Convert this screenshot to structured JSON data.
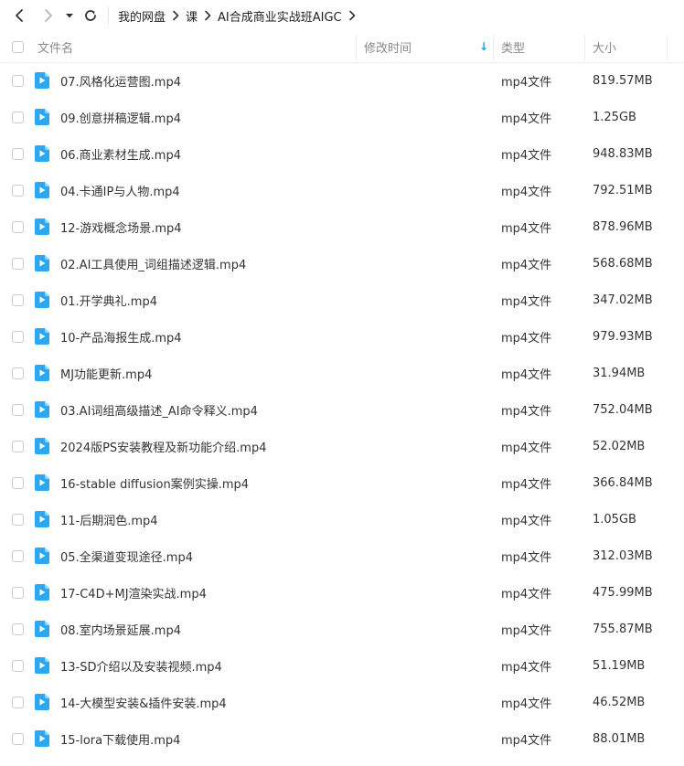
{
  "breadcrumb": [
    "我的网盘",
    "课",
    "AI合成商业实战班AIGC"
  ],
  "columns": {
    "name": "文件名",
    "modified": "修改时间",
    "type": "类型",
    "size": "大小"
  },
  "sort": {
    "column": "modified",
    "indicator": "↓"
  },
  "colors": {
    "accent": "#06a7ff",
    "icon_blue": "#2aa8f2"
  },
  "files": [
    {
      "name": "07.风格化运营图.mp4",
      "type": "mp4文件",
      "size": "819.57MB"
    },
    {
      "name": "09.创意拼稿逻辑.mp4",
      "type": "mp4文件",
      "size": "1.25GB"
    },
    {
      "name": "06.商业素材生成.mp4",
      "type": "mp4文件",
      "size": "948.83MB"
    },
    {
      "name": "04.卡通IP与人物.mp4",
      "type": "mp4文件",
      "size": "792.51MB"
    },
    {
      "name": "12-游戏概念场景.mp4",
      "type": "mp4文件",
      "size": "878.96MB"
    },
    {
      "name": "02.AI工具使用_词组描述逻辑.mp4",
      "type": "mp4文件",
      "size": "568.68MB"
    },
    {
      "name": "01.开学典礼.mp4",
      "type": "mp4文件",
      "size": "347.02MB"
    },
    {
      "name": "10-产品海报生成.mp4",
      "type": "mp4文件",
      "size": "979.93MB"
    },
    {
      "name": "MJ功能更新.mp4",
      "type": "mp4文件",
      "size": "31.94MB"
    },
    {
      "name": "03.AI词组高级描述_AI命令释义.mp4",
      "type": "mp4文件",
      "size": "752.04MB"
    },
    {
      "name": "2024版PS安装教程及新功能介绍.mp4",
      "type": "mp4文件",
      "size": "52.02MB"
    },
    {
      "name": "16-stable diffusion案例实操.mp4",
      "type": "mp4文件",
      "size": "366.84MB"
    },
    {
      "name": "11-后期润色.mp4",
      "type": "mp4文件",
      "size": "1.05GB"
    },
    {
      "name": "05.全渠道变现途径.mp4",
      "type": "mp4文件",
      "size": "312.03MB"
    },
    {
      "name": "17-C4D+MJ渲染实战.mp4",
      "type": "mp4文件",
      "size": "475.99MB"
    },
    {
      "name": "08.室内场景延展.mp4",
      "type": "mp4文件",
      "size": "755.87MB"
    },
    {
      "name": "13-SD介绍以及安装视频.mp4",
      "type": "mp4文件",
      "size": "51.19MB"
    },
    {
      "name": "14-大模型安装&插件安装.mp4",
      "type": "mp4文件",
      "size": "46.52MB"
    },
    {
      "name": "15-lora下载使用.mp4",
      "type": "mp4文件",
      "size": "88.01MB"
    }
  ]
}
